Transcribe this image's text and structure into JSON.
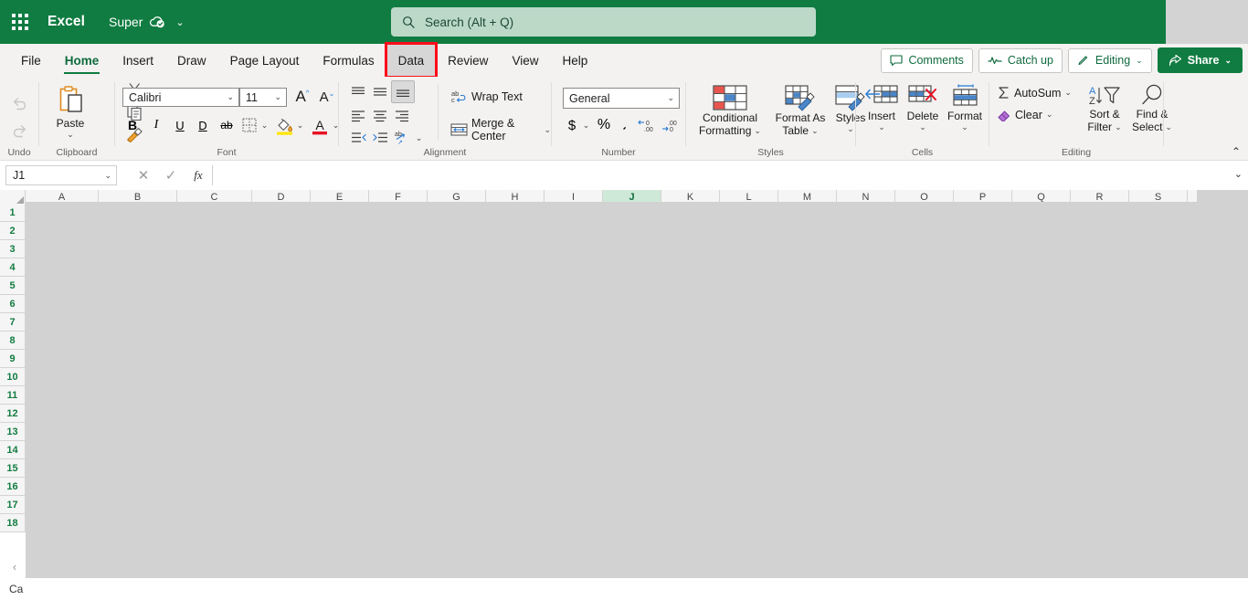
{
  "titlebar": {
    "waffle_label": "app-launcher",
    "app_name": "Excel",
    "document_name": "Super",
    "doc_caret": "⌄"
  },
  "search": {
    "placeholder": "Search (Alt + Q)"
  },
  "ribbon_tabs": [
    {
      "label": "File",
      "state": "normal"
    },
    {
      "label": "Home",
      "state": "active"
    },
    {
      "label": "Insert",
      "state": "normal"
    },
    {
      "label": "Draw",
      "state": "normal"
    },
    {
      "label": "Page Layout",
      "state": "normal"
    },
    {
      "label": "Formulas",
      "state": "normal"
    },
    {
      "label": "Data",
      "state": "highlighted"
    },
    {
      "label": "Review",
      "state": "normal"
    },
    {
      "label": "View",
      "state": "normal"
    },
    {
      "label": "Help",
      "state": "normal"
    }
  ],
  "highlight_color": "#fc0d1b",
  "accent_color": "#107C41",
  "tab_actions": {
    "comments": "Comments",
    "catch_up": "Catch up",
    "editing": "Editing",
    "editing_caret": "⌄",
    "share": "Share",
    "share_caret": "⌄"
  },
  "groups": {
    "undo": {
      "label": "Undo",
      "undo_name": "undo-button",
      "redo_name": "redo-button"
    },
    "clipboard": {
      "label": "Clipboard",
      "paste": "Paste",
      "paste_caret": "⌄",
      "cut": "cut-icon",
      "copy": "copy-icon",
      "format_painter": "format-painter-icon"
    },
    "font": {
      "label": "Font",
      "font_family": "Calibri",
      "font_size": "11",
      "caret": "⌄",
      "grow_font": "A",
      "shrink_font": "A",
      "bold": "B",
      "italic": "I",
      "underline": "U",
      "double_underline": "D",
      "strikethrough": "ab",
      "borders_caret": "⌄",
      "fill_caret": "⌄",
      "fontcolor_caret": "⌄",
      "fill_color": "#ffe600",
      "font_color": "#e81123"
    },
    "alignment": {
      "label": "Alignment",
      "wrap_text": "Wrap Text",
      "merge_center": "Merge & Center",
      "merge_caret": "⌄",
      "orientation_caret": "⌄"
    },
    "number": {
      "label": "Number",
      "format": "General",
      "caret": "⌄",
      "currency": "$",
      "currency_caret": "⌄",
      "percent": "%",
      "comma": "͵"
    },
    "styles": {
      "label": "Styles",
      "conditional_formatting": "Conditional\nFormatting",
      "conditional_formatting_l1": "Conditional",
      "conditional_formatting_l2": "Formatting",
      "format_as_table_l1": "Format As",
      "format_as_table_l2": "Table",
      "styles_btn": "Styles",
      "caret": "⌄"
    },
    "cells": {
      "label": "Cells",
      "insert": "Insert",
      "delete": "Delete",
      "format": "Format",
      "caret": "⌄"
    },
    "editing": {
      "label": "Editing",
      "autosum": "AutoSum",
      "clear": "Clear",
      "sort_filter_l1": "Sort &",
      "sort_filter_l2": "Filter",
      "find_select_l1": "Find &",
      "find_select_l2": "Select",
      "caret": "⌄"
    }
  },
  "ribbon_collapse_caret": "⌃",
  "formula_bar": {
    "name_box_value": "J1",
    "name_box_caret": "⌄",
    "cancel": "✕",
    "enter": "✓",
    "function": "fx",
    "formula_value": "",
    "expand_caret": "⌄"
  },
  "grid": {
    "columns": [
      "A",
      "B",
      "C",
      "D",
      "E",
      "F",
      "G",
      "H",
      "I",
      "J",
      "K",
      "L",
      "M",
      "N",
      "O",
      "P",
      "Q",
      "R",
      "S"
    ],
    "selected_column": "J",
    "rows": [
      "1",
      "2",
      "3",
      "4",
      "5",
      "6",
      "7",
      "8",
      "9",
      "10",
      "11",
      "12",
      "13",
      "14",
      "15",
      "16",
      "17",
      "18"
    ],
    "sheet_nav_prev": "‹"
  },
  "status_bar": {
    "text": "Ca"
  }
}
